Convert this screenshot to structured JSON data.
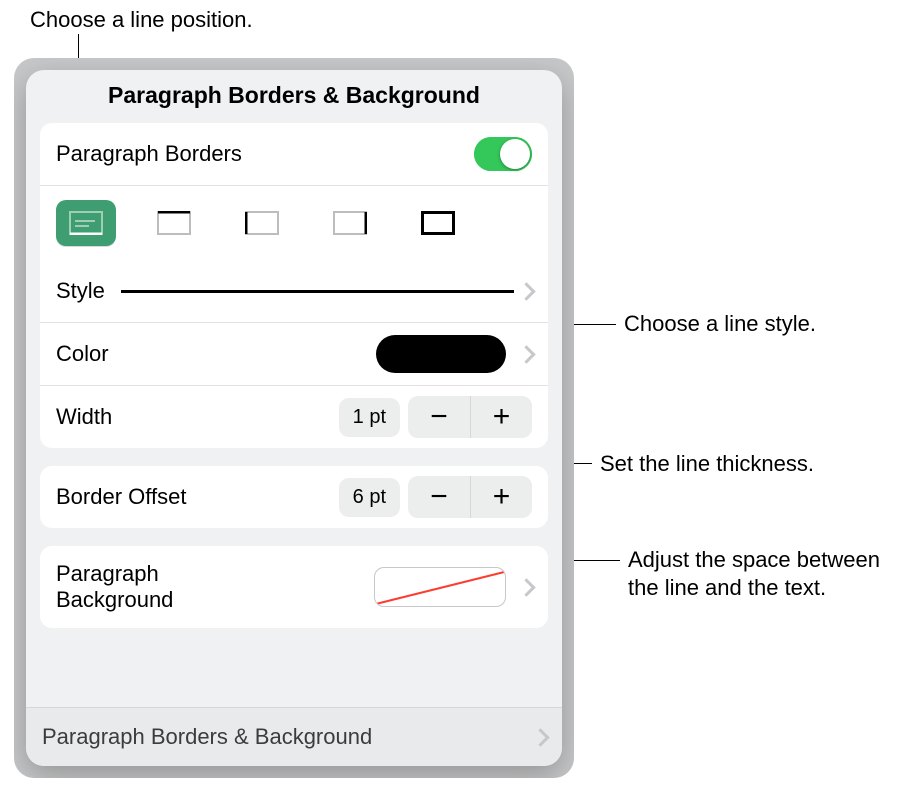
{
  "callouts": {
    "top": "Choose a line position.",
    "style": "Choose a line style.",
    "width": "Set the line thickness.",
    "offset": "Adjust the space between the line and the text."
  },
  "panel": {
    "title": "Paragraph Borders & Background",
    "toggle_label": "Paragraph Borders",
    "toggle_on": true,
    "positions": [
      "bottom",
      "top",
      "left",
      "right",
      "outline"
    ],
    "active_position_index": 0,
    "style": {
      "label": "Style",
      "selected": "solid"
    },
    "color": {
      "label": "Color",
      "value": "#000000"
    },
    "width": {
      "label": "Width",
      "value": "1 pt"
    },
    "offset": {
      "label": "Border Offset",
      "value": "6 pt"
    },
    "background": {
      "label": "Paragraph\nBackground",
      "value": "none"
    },
    "source_row": "Paragraph Borders & Background"
  }
}
